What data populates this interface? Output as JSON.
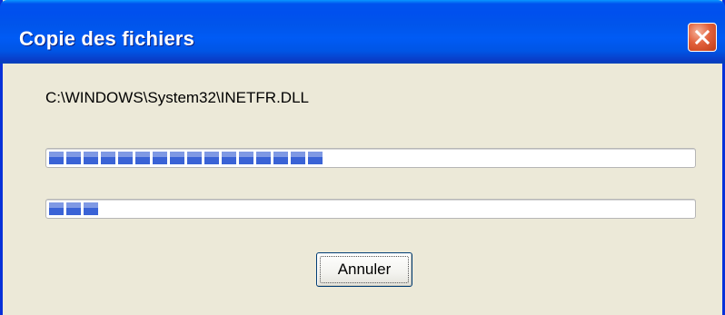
{
  "window": {
    "title": "Copie des fichiers",
    "close_icon": "close-icon"
  },
  "content": {
    "current_file": "C:\\WINDOWS\\System32\\INETFR.DLL",
    "file_progress": 0.42,
    "total_progress": 0.08
  },
  "buttons": {
    "cancel_label": "Annuler"
  },
  "colors": {
    "titlebar": "#0053ee",
    "progress_block": "#3a63d6",
    "close_button": "#e2613c",
    "dialog_bg": "#ece9d8"
  }
}
